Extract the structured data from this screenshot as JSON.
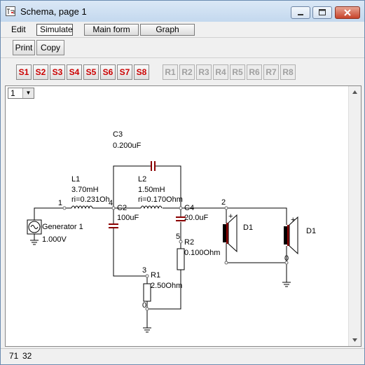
{
  "window": {
    "title": "Schema, page 1"
  },
  "menu": {
    "edit": "Edit",
    "simulate": "Simulate",
    "main_form": "Main form",
    "graph": "Graph"
  },
  "toolbar": {
    "print": "Print",
    "copy": "Copy"
  },
  "s_buttons": [
    "S1",
    "S2",
    "S3",
    "S4",
    "S5",
    "S6",
    "S7",
    "S8"
  ],
  "r_buttons": [
    "R1",
    "R2",
    "R3",
    "R4",
    "R5",
    "R6",
    "R7",
    "R8"
  ],
  "page_select": {
    "value": "1"
  },
  "schematic": {
    "c3": {
      "name": "C3",
      "value": "0.200uF"
    },
    "l1": {
      "name": "L1",
      "value": "3.70mH",
      "ri": "ri=0.231Oh"
    },
    "l2": {
      "name": "L2",
      "value": "1.50mH",
      "ri": "ri=0.170Ohm"
    },
    "c2": {
      "name": "C2",
      "value": "100uF"
    },
    "c4": {
      "name": "C4",
      "value": "20.0uF"
    },
    "r1": {
      "name": "R1",
      "value": "2.50Ohm"
    },
    "r2": {
      "name": "R2",
      "value": "0.100Ohm"
    },
    "generator": {
      "name": "Generator 1",
      "value": "1.000V"
    },
    "speaker1": {
      "name": "D1"
    },
    "speaker2": {
      "name": "D1"
    },
    "nodes": {
      "n1": "1",
      "n2": "2",
      "n3": "3",
      "n4": "4",
      "n5": "5",
      "n0a": "0",
      "n0b": "0"
    },
    "polarity_plus": "+"
  },
  "status": {
    "x": "71",
    "y": "32"
  },
  "colors": {
    "wire": "#000000",
    "capacitor": "#8b0000",
    "s_buttons": "#cc0000",
    "speaker_plus": "#cc0000"
  }
}
